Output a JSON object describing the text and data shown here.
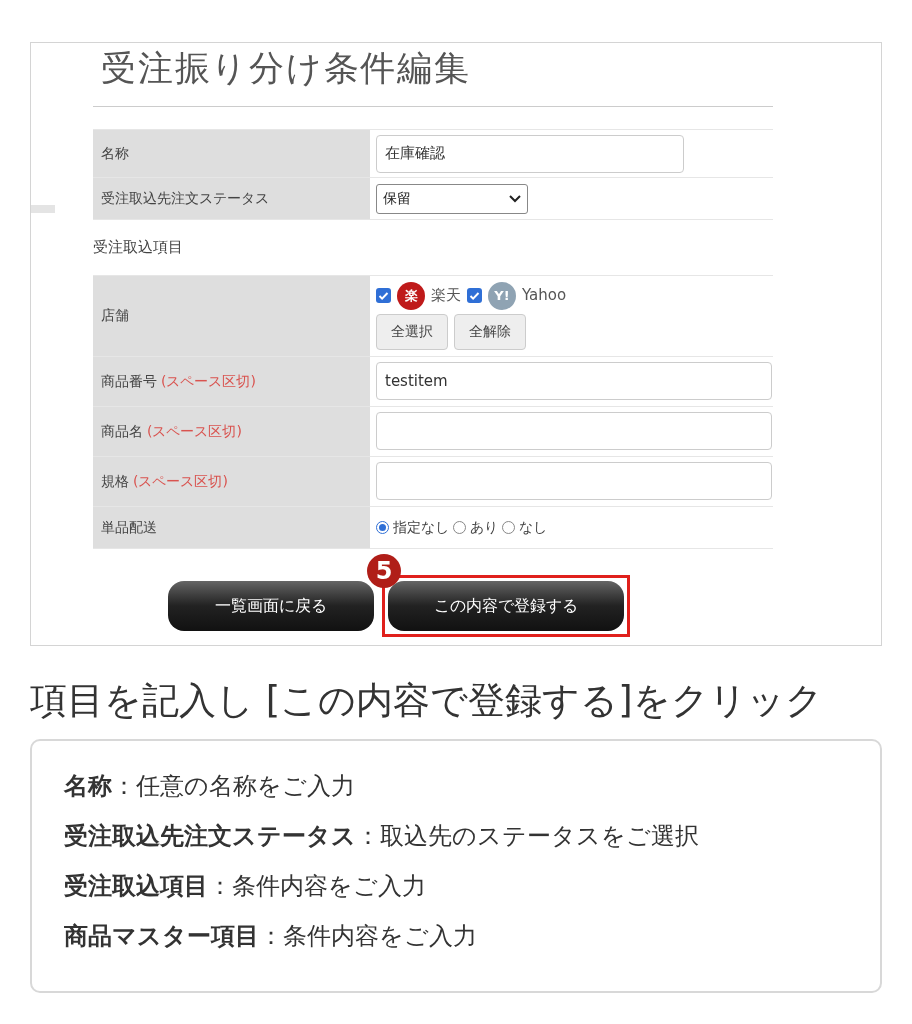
{
  "screenshot": {
    "title": "受注振り分け条件編集",
    "fields": [
      {
        "kind": "text",
        "label": "名称",
        "value": "在庫確認"
      },
      {
        "kind": "select",
        "label": "受注取込先注文ステータス",
        "value": "保留"
      }
    ],
    "section": "受注取込項目",
    "items": [
      {
        "kind": "stores",
        "label": "店舗",
        "stores": [
          {
            "logo": "楽",
            "name": "楽天",
            "checked": true,
            "color": "#bf1a1a"
          },
          {
            "logo": "Y!",
            "name": "Yahoo",
            "checked": true,
            "color": "#8fa3b3"
          }
        ],
        "buttons": [
          "全選択",
          "全解除"
        ]
      },
      {
        "kind": "text",
        "label": "商品番号",
        "note": "(スペース区切)",
        "value": "testitem"
      },
      {
        "kind": "text",
        "label": "商品名",
        "note": "(スペース区切)"
      },
      {
        "kind": "text",
        "label": "規格",
        "note": "(スペース区切)"
      },
      {
        "kind": "radio",
        "label": "単品配送",
        "options": [
          {
            "label": "指定なし",
            "selected": true
          },
          {
            "label": "あり",
            "selected": false
          },
          {
            "label": "なし",
            "selected": false
          }
        ]
      }
    ],
    "actions": [
      {
        "label": "一覧画面に戻る",
        "highlighted": false
      },
      {
        "label": "この内容で登録する",
        "highlighted": true,
        "step": "5"
      }
    ]
  },
  "caption": "項目を記入し [この内容で登録する]をクリック",
  "notes": [
    "**名称**：任意の名称をご入力",
    "**受注取込先注文ステータス**：取込先のステータスをご選択",
    "**受注取込項目**：条件内容をご入力",
    "**商品マスター項目**：条件内容をご入力"
  ]
}
